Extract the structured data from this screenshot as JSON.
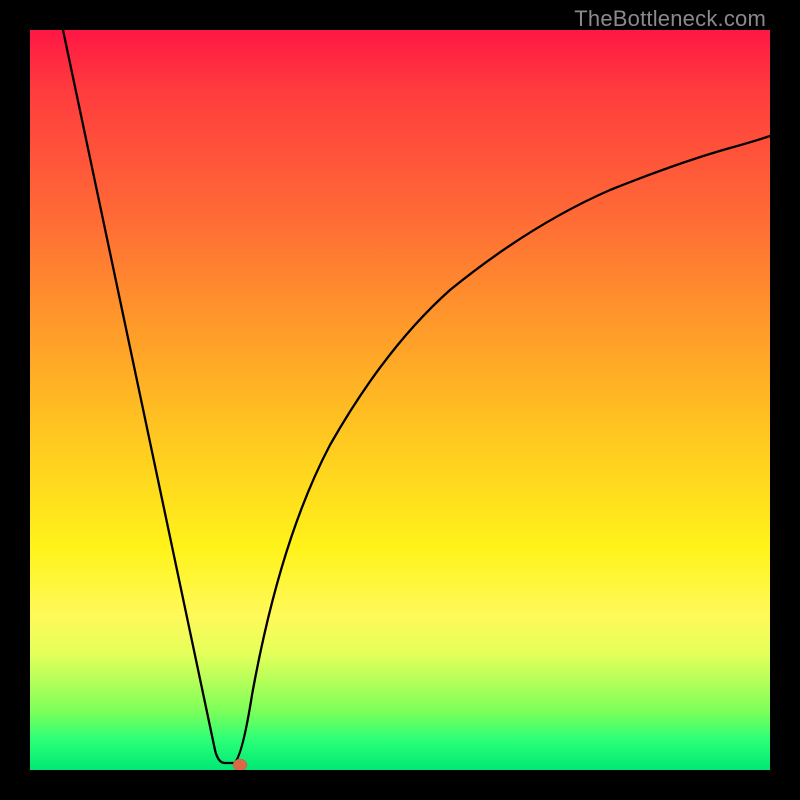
{
  "watermark": "TheBottleneck.com",
  "chart_data": {
    "type": "line",
    "title": "",
    "xlabel": "",
    "ylabel": "",
    "xlim": [
      0,
      1
    ],
    "ylim": [
      0,
      1
    ],
    "series": [
      {
        "name": "left-branch",
        "x": [
          0.045,
          0.26
        ],
        "y": [
          1.0,
          0.01
        ]
      },
      {
        "name": "right-branch",
        "x": [
          0.28,
          0.31,
          0.35,
          0.4,
          0.45,
          0.5,
          0.55,
          0.6,
          0.65,
          0.7,
          0.75,
          0.8,
          0.85,
          0.9,
          0.95,
          1.0
        ],
        "y": [
          0.01,
          0.12,
          0.25,
          0.38,
          0.48,
          0.56,
          0.625,
          0.68,
          0.725,
          0.76,
          0.79,
          0.815,
          0.833,
          0.847,
          0.857,
          0.865
        ]
      }
    ],
    "marker": {
      "name": "minimum-point",
      "x": 0.27,
      "y": 0.005,
      "color": "#e07050"
    },
    "gradient_stops": [
      {
        "pos": 0.0,
        "color": "#ff1744"
      },
      {
        "pos": 0.55,
        "color": "#ffc820"
      },
      {
        "pos": 0.8,
        "color": "#fff95a"
      },
      {
        "pos": 1.0,
        "color": "#00e874"
      }
    ]
  }
}
